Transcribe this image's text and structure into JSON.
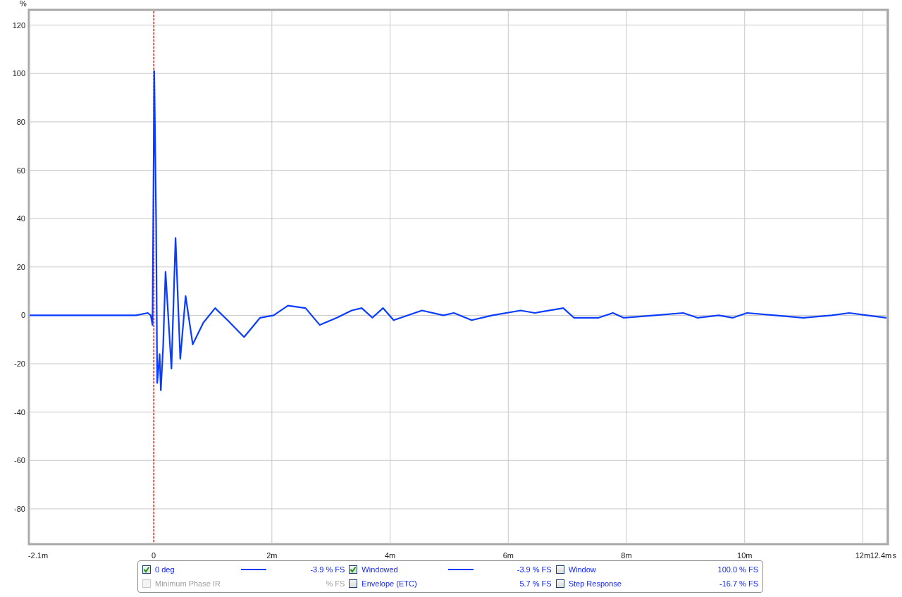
{
  "chart": {
    "chart_data": {
      "type": "line",
      "ylabel": "%",
      "xlabel": "s",
      "xlim": [
        -2.1,
        12.4
      ],
      "ylim": [
        -94,
        126
      ],
      "xticks": [
        {
          "value": -2.1,
          "label": "-2.1m"
        },
        {
          "value": 0,
          "label": "0"
        },
        {
          "value": 2,
          "label": "2m"
        },
        {
          "value": 4,
          "label": "4m"
        },
        {
          "value": 6,
          "label": "6m"
        },
        {
          "value": 8,
          "label": "8m"
        },
        {
          "value": 10,
          "label": "10m"
        },
        {
          "value": 12,
          "label": "12m"
        },
        {
          "value": 12.4,
          "label": "12.4m"
        }
      ],
      "yticks": [
        -80,
        -60,
        -40,
        -20,
        0,
        20,
        40,
        60,
        80,
        100,
        120
      ],
      "grid": true,
      "ref_lines": [
        {
          "axis": "x",
          "value": 0,
          "color": "#ff0000"
        }
      ],
      "x": [
        -2.1,
        -0.3,
        -0.1,
        -0.05,
        -0.02,
        0.01,
        0.04,
        0.06,
        0.1,
        0.12,
        0.16,
        0.2,
        0.3,
        0.37,
        0.45,
        0.54,
        0.66,
        0.84,
        1.04,
        1.25,
        1.53,
        1.8,
        2.03,
        2.27,
        2.57,
        2.81,
        3.1,
        3.35,
        3.52,
        3.7,
        3.88,
        4.06,
        4.54,
        4.9,
        5.08,
        5.38,
        5.73,
        6.21,
        6.45,
        6.93,
        7.11,
        7.53,
        7.77,
        7.95,
        8.48,
        8.96,
        9.2,
        9.56,
        9.8,
        10.04,
        10.51,
        10.99,
        11.47,
        11.77,
        12.07,
        12.4
      ],
      "series": [
        {
          "color": "#0a3cff",
          "values": [
            0,
            0,
            1,
            0,
            -4,
            101,
            40,
            -28,
            -16,
            -31,
            -13,
            18,
            -22,
            32,
            -18,
            8,
            -12,
            -3,
            3,
            -2,
            -9,
            -1,
            0,
            4,
            3,
            -4,
            -1,
            2,
            3,
            -1,
            3,
            -2,
            2,
            0,
            1,
            -2,
            0,
            2,
            1,
            3,
            -1,
            -1,
            1,
            -1,
            0,
            1,
            -1,
            0,
            -1,
            1,
            0,
            -1,
            0,
            1,
            0,
            -1
          ]
        }
      ]
    }
  },
  "legend": {
    "items": [
      {
        "label": "0 deg",
        "checked": true,
        "disabled": false,
        "swatch": true,
        "value": "-3.9 % FS"
      },
      {
        "label": "Windowed",
        "checked": true,
        "disabled": false,
        "swatch": true,
        "value": "-3.9 % FS"
      },
      {
        "label": "Window",
        "checked": false,
        "disabled": false,
        "swatch": false,
        "value": "100.0 % FS"
      },
      {
        "label": "Minimum Phase IR",
        "checked": false,
        "disabled": true,
        "swatch": false,
        "value": "% FS"
      },
      {
        "label": "Envelope (ETC)",
        "checked": false,
        "disabled": false,
        "swatch": false,
        "value": "5.7 % FS"
      },
      {
        "label": "Step Response",
        "checked": false,
        "disabled": false,
        "swatch": false,
        "value": "-16.7 % FS"
      }
    ]
  }
}
